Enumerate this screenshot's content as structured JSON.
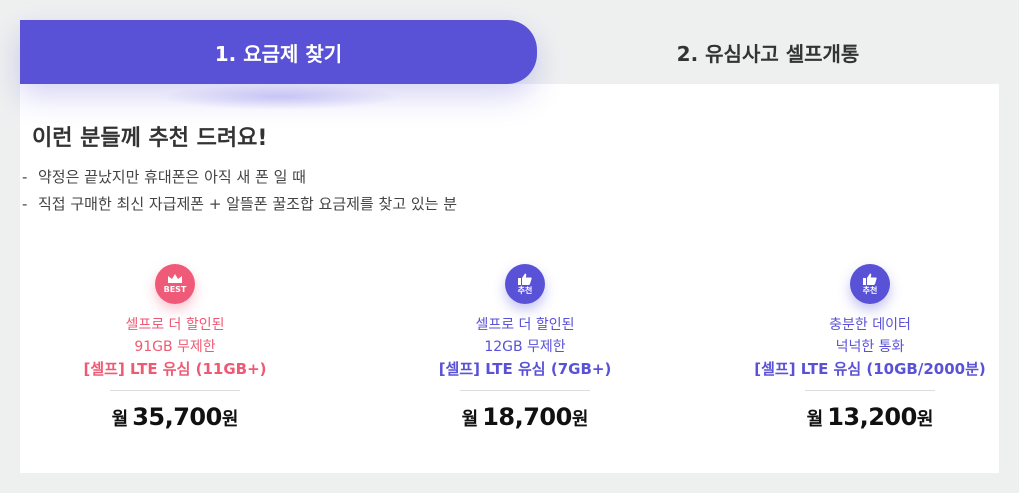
{
  "tabs": [
    {
      "label": "1. 요금제 찾기",
      "active": true
    },
    {
      "label": "2. 유심사고 셀프개통",
      "active": false
    }
  ],
  "headline": "이런 분들께 추천 드려요!",
  "bullets": [
    "약정은 끝났지만 휴대폰은 아직 새 폰 일 때",
    "직접 구매한 최신 자급제폰 + 알뜰폰 꿀조합 요금제를 찾고 있는 분"
  ],
  "colors": {
    "accent": "#5a52d6",
    "best": "#ef5a78"
  },
  "cards": [
    {
      "badge_icon": "crown-icon",
      "badge_text": "BEST",
      "desc_line1": "셀프로 더 할인된",
      "desc_line2": "91GB 무제한",
      "plan": "[셀프] LTE 유심 (11GB+)",
      "price_prefix": "월",
      "price_amount": "35,700",
      "price_unit": "원"
    },
    {
      "badge_icon": "thumbs-up-icon",
      "badge_text": "추천",
      "desc_line1": "셀프로 더 할인된",
      "desc_line2": "12GB 무제한",
      "plan": "[셀프] LTE 유심 (7GB+)",
      "price_prefix": "월",
      "price_amount": "18,700",
      "price_unit": "원"
    },
    {
      "badge_icon": "thumbs-up-icon",
      "badge_text": "추천",
      "desc_line1": "충분한 데이터",
      "desc_line2": "넉넉한 통화",
      "plan": "[셀프] LTE 유심 (10GB/2000분)",
      "price_prefix": "월",
      "price_amount": "13,200",
      "price_unit": "원"
    }
  ]
}
